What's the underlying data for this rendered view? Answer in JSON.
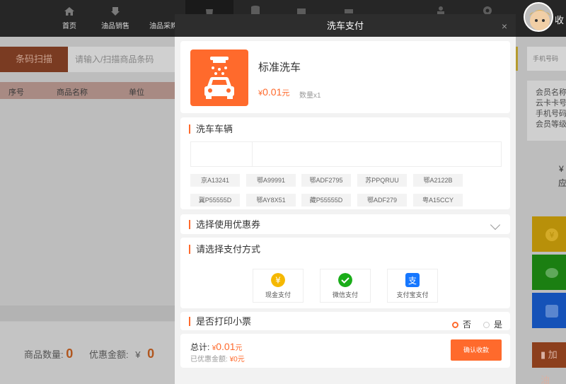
{
  "nav": {
    "items": [
      {
        "label": "首页",
        "icon": "home-icon"
      },
      {
        "label": "油品销售",
        "icon": "fuel-icon"
      },
      {
        "label": "油品采购",
        "icon": "purchase-icon"
      }
    ],
    "user_name": "收"
  },
  "left": {
    "scan_button": "条码扫描",
    "scan_placeholder": "请输入/扫描商品条码",
    "table_headers": [
      "序号",
      "商品名称",
      "单位"
    ],
    "goods_count_label": "商品数量:",
    "goods_count": "0",
    "discount_label": "优惠金额:",
    "discount_currency": "¥",
    "discount_value": "0"
  },
  "right": {
    "phone_placeholder": "手机号码",
    "member_lines": [
      "会员名称",
      "云卡卡号",
      "手机号码",
      "会员等级"
    ],
    "amount_symbol": "¥",
    "amount_label": "应",
    "add_button": "加油"
  },
  "modal": {
    "title": "洗车支付",
    "close": "×",
    "product": {
      "name": "标准洗车",
      "price_symbol": "¥",
      "price": "0.01",
      "price_unit": "元",
      "qty": "数量x1",
      "icon": "car-wash-icon"
    },
    "vehicle_section": "洗车车辆",
    "plates": [
      "京A13241",
      "鄂A99991",
      "鄂ADF2795",
      "苏PPQRUU",
      "鄂A2122B",
      "冀P55555D",
      "鄂AY8X51",
      "藏P55555D",
      "鄂ADF279",
      "粤A15CCY"
    ],
    "coupon_section": "选择使用优惠券",
    "payment_section": "请选择支付方式",
    "payments": [
      {
        "label": "现金支付",
        "icon": "cash-icon",
        "color": "#f5b800"
      },
      {
        "label": "微信支付",
        "icon": "wechat-icon",
        "color": "#1aad19"
      },
      {
        "label": "支付宝支付",
        "icon": "alipay-icon",
        "color": "#1677ff"
      }
    ],
    "print_section": "是否打印小票",
    "print_no": "否",
    "print_yes": "是",
    "print_selected": "否",
    "total_label": "总计:",
    "total_symbol": "¥",
    "total_value": "0.01",
    "total_unit": "元",
    "discounted_label": "已优惠金额:",
    "discounted_symbol": "¥",
    "discounted_value": "0",
    "discounted_unit": "元",
    "confirm_button": "确认收款",
    "accent_color": "#ff6a2c"
  }
}
